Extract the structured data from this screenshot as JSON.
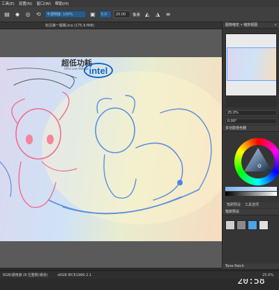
{
  "menubar": [
    "工具(E)",
    "设置(N)",
    "窗口(W)",
    "帮助(H)"
  ],
  "toolbar": {
    "opacity_value": "不透明度: 100%",
    "size_value": "5.0",
    "size_value2": "20.00",
    "size_unit": "像素"
  },
  "document": {
    "title": "标注第一版稿.kra (175.9 MiB)"
  },
  "canvas": {
    "logo_text_cn": "超低功耗",
    "logo_text_en": "Ultra Low Voltage",
    "brand": "intel"
  },
  "right_panel": {
    "overview_title": "图像缩览 • 缩放视图",
    "zoom_label": "25.0%",
    "rotate_label": "0.00°",
    "color_title": "多功能拾色器",
    "brush_tabs": [
      "笔刷预设",
      "工具选项"
    ],
    "brush_section": "笔刷预设",
    "timer_title": "Tone Patch",
    "clock_display": "20:58"
  },
  "statusbar": {
    "color_model": "RGB/通用度 (8 位整数/通道)",
    "profile": "sRGB IEC61966-2.1",
    "zoom": "25.0%"
  },
  "colors": {
    "accent": "#2a5a85",
    "canvas_bg": "#5a5a5a",
    "panel_bg": "#353535"
  }
}
